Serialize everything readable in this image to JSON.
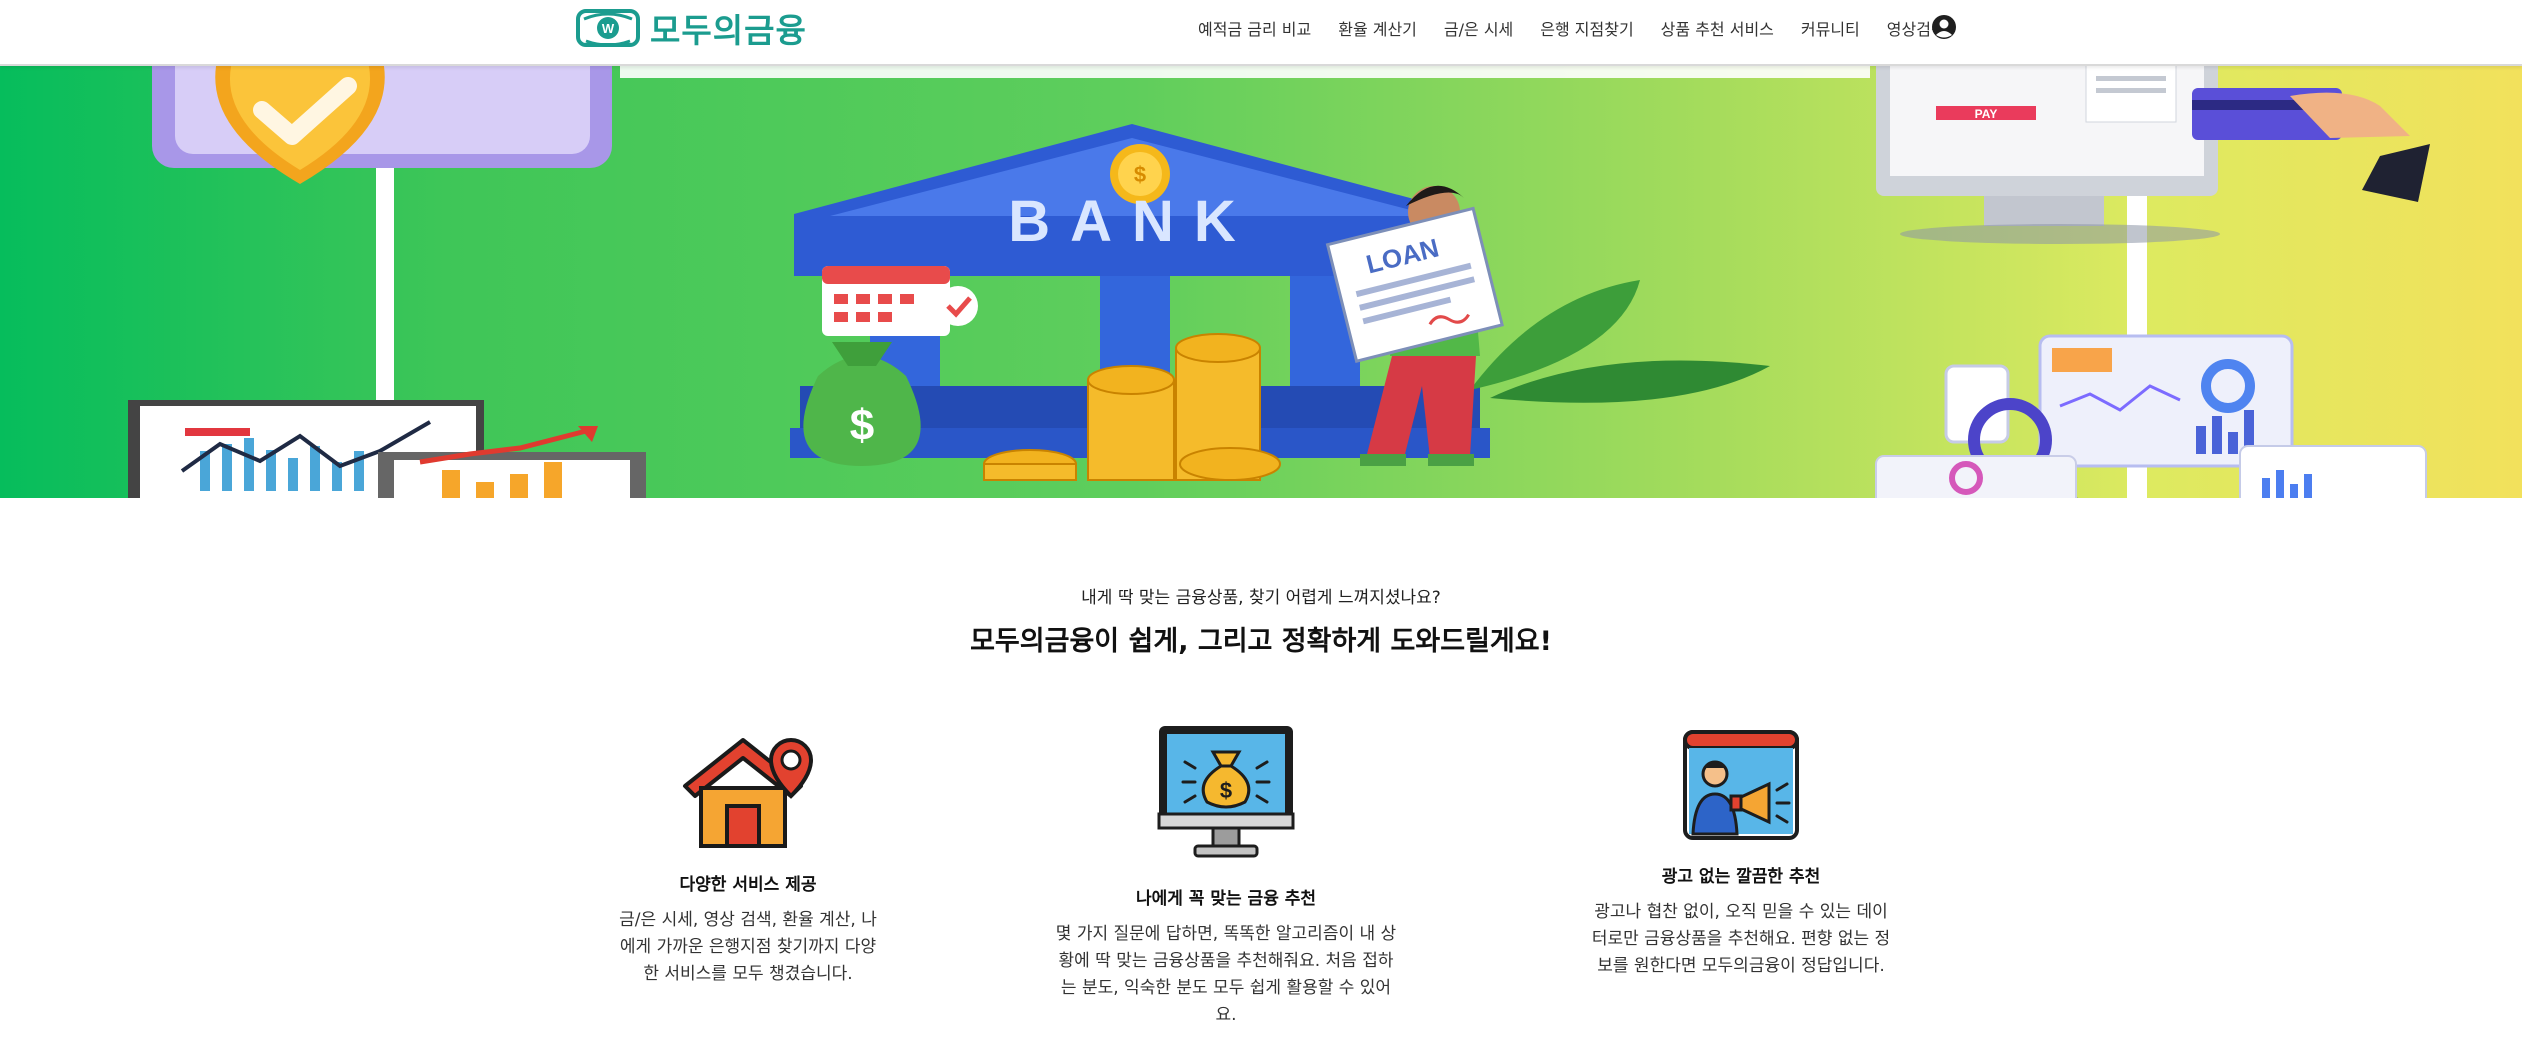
{
  "brand": {
    "name": "모두의금융",
    "mark_letter": "W",
    "color": "#1b9c8f"
  },
  "nav": {
    "items": [
      {
        "label": "예적금 금리 비교"
      },
      {
        "label": "환율 계산기"
      },
      {
        "label": "금/은 시세"
      },
      {
        "label": "은행 지점찾기"
      },
      {
        "label": "상품 추천 서비스"
      },
      {
        "label": "커뮤니티"
      },
      {
        "label": "영상검색"
      }
    ],
    "user_icon": "user-circle-icon"
  },
  "hero": {
    "bank_sign": "BANK",
    "loan_sign": "LOAN",
    "pay_sign": "PAY",
    "dollar": "$"
  },
  "intro": {
    "subtitle": "내게 딱 맞는 금융상품, 찾기 어렵게 느껴지셨나요?",
    "title": "모두의금융이 쉽게, 그리고 정확하게 도와드릴게요!"
  },
  "features": [
    {
      "icon": "house-location-icon",
      "title": "다양한 서비스 제공",
      "description": "금/은 시세, 영상 검색, 환율 계산, 나에게 가까운 은행지점 찾기까지 다양한 서비스를 모두 챙겼습니다."
    },
    {
      "icon": "monitor-money-bag-icon",
      "title": "나에게 꼭 맞는 금융 추천",
      "description": "몇 가지 질문에 답하면, 똑똑한 알고리즘이 내 상황에 딱 맞는 금융상품을 추천해줘요. 처음 접하는 분도, 익숙한 분도 모두 쉽게 활용할 수 있어요."
    },
    {
      "icon": "megaphone-presenter-icon",
      "title": "광고 없는 깔끔한 추천",
      "description": "광고나 협찬 없이, 오직 믿을 수 있는 데이터로만 금융상품을 추천해요. 편향 없는 정보를 원한다면 모두의금융이 정답입니다."
    }
  ]
}
